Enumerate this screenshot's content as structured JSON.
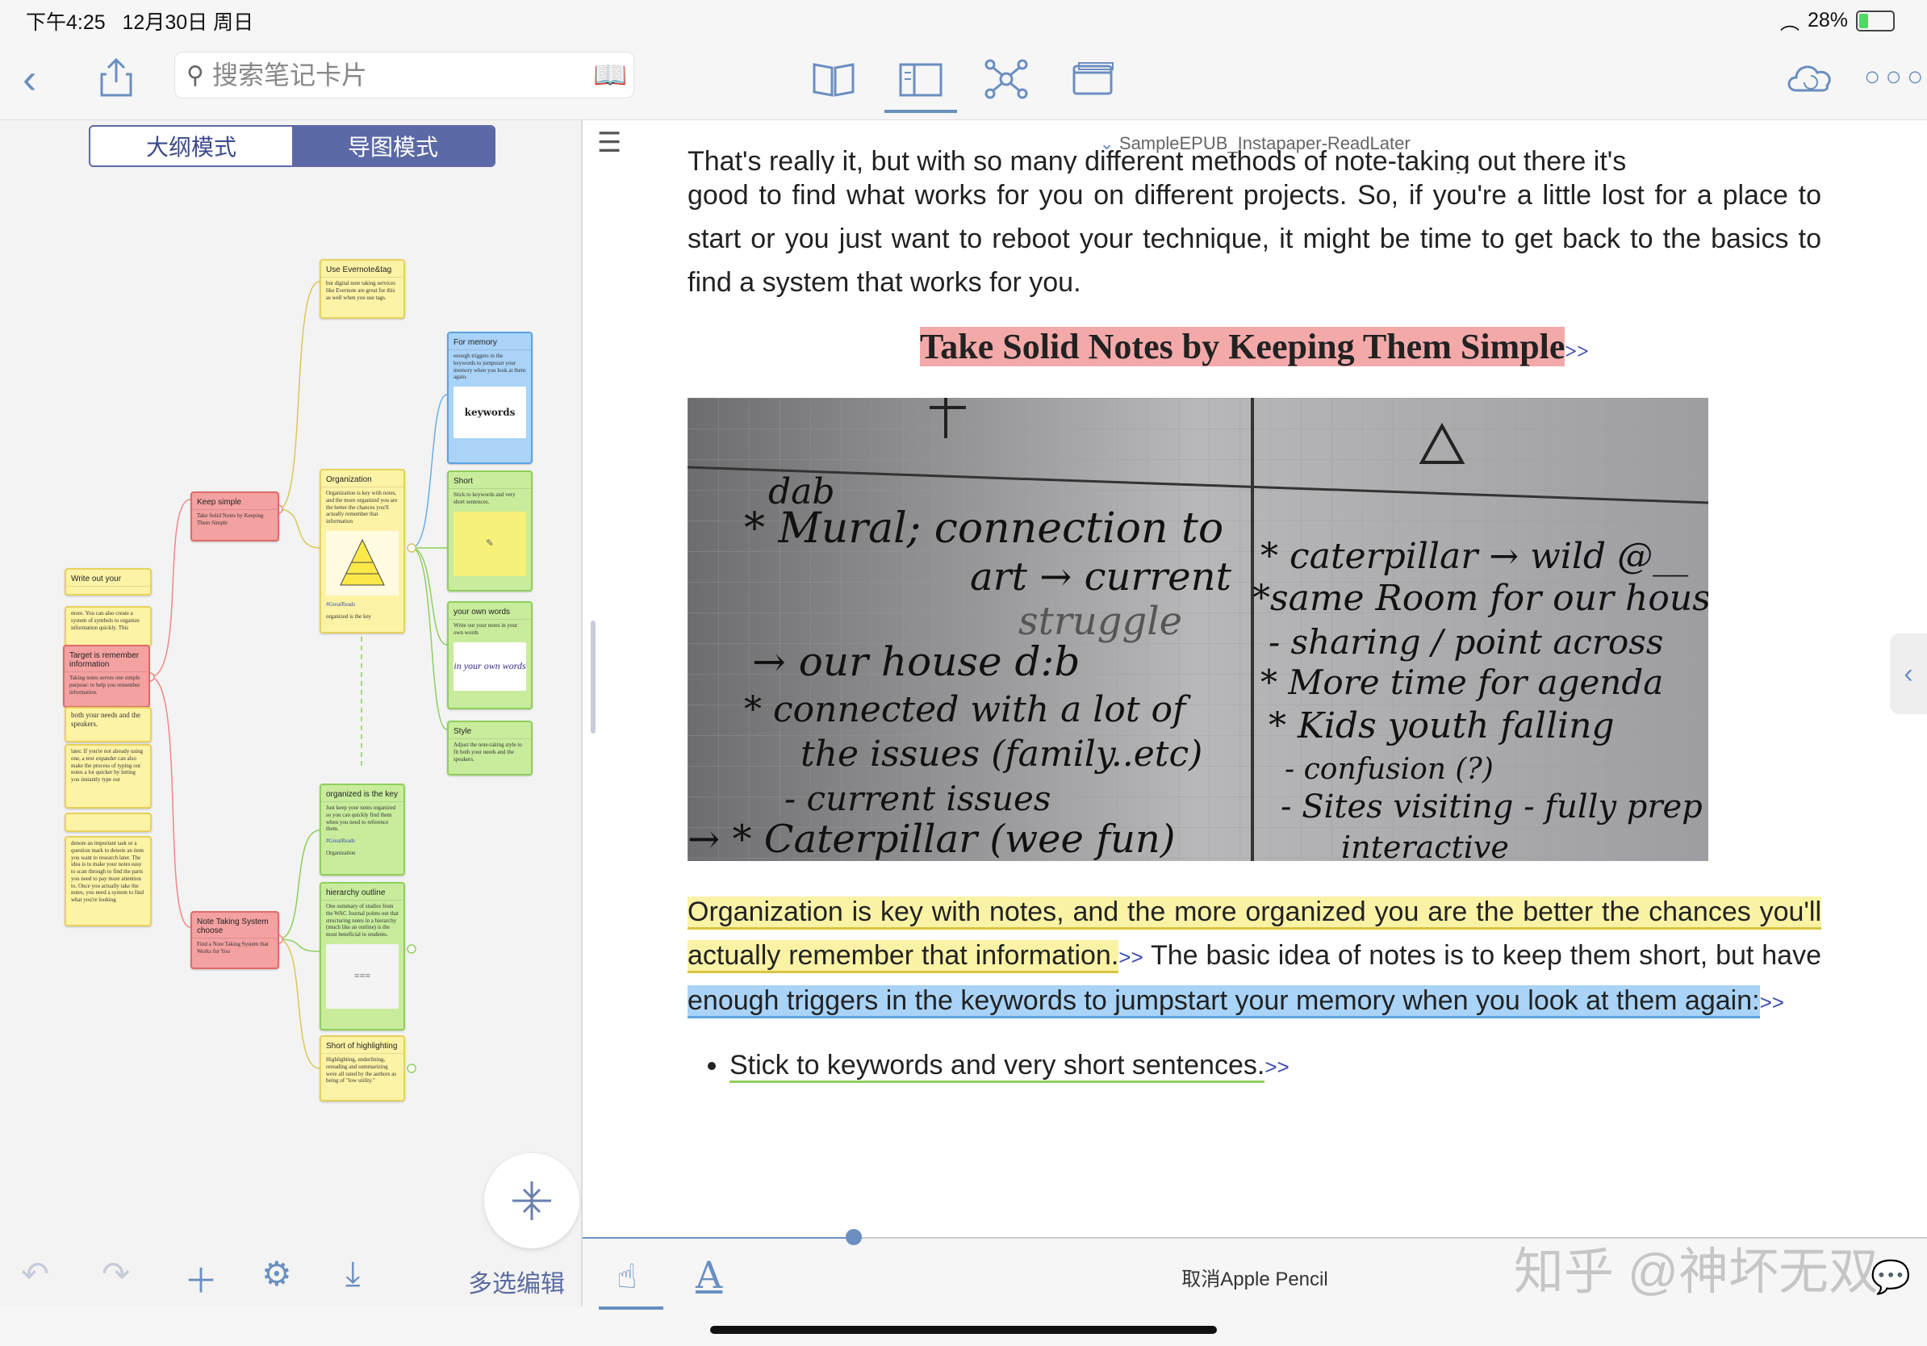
{
  "status": {
    "time": "下午4:25",
    "date": "12月30日 周日",
    "battery": "28%",
    "battery_level": 0.28
  },
  "toolbar": {
    "search_placeholder": "搜索笔记卡片",
    "icons": [
      "back-icon",
      "share-icon",
      "book-icon",
      "card-layout-icon",
      "mindmap-icon",
      "window-icon",
      "cloud-sync-icon",
      "more-icon"
    ]
  },
  "left": {
    "mode_outline": "大纲模式",
    "mode_map": "导图模式",
    "multi_edit": "多选编辑",
    "nodes": {
      "keep_simple": {
        "title": "Keep simple",
        "body": "Take Solid Notes by Keeping Them Simple"
      },
      "note_system": {
        "title": "Note Taking System choose",
        "body": "Find a Note Taking System that Works for You"
      },
      "target": {
        "title": "Target is remember information",
        "body": "Taking notes serves one simple purpose: to help you remember information."
      },
      "write_own": {
        "title": "Write out your"
      },
      "left2": {
        "body": "more. You can also create a system of symbols to organize information quickly. This"
      },
      "left3": {
        "body": "both your needs and the speakers."
      },
      "left4": {
        "body": "later. If you're not already using one, a text expander can also make the process of typing out notes a lot quicker by letting you instantly type out"
      },
      "left5": {
        "body": "denote an important task or a question mark to denote an item you want to research later. The idea is to make your notes easy to scan through to find the parts you need to pay more attention to. Once you actually take the notes, you need a system to find what you're looking"
      },
      "evernote": {
        "title": "Use Evernote&tag",
        "body": "but digital note taking services like Evernote are great for this as well when you use tags."
      },
      "organization": {
        "title": "Organization",
        "body": "Organization is key with notes, and the more organized you are the better the chances you'll actually remember that information",
        "tag": "#GreatReads",
        "foot": "organized is the key"
      },
      "for_memory": {
        "title": "For memory",
        "body": "enough triggers in the keywords to jumpstart your memory when you look at them again.",
        "thumb": "keywords"
      },
      "short": {
        "title": "Short",
        "body": "Stick to keywords and very short sentences."
      },
      "own_words": {
        "title": "your own words",
        "body": "Write out your notes in your own words",
        "thumb": "in your own words"
      },
      "style": {
        "title": "Style",
        "body": "Adjust the note-taking style to fit both your needs and the speakers."
      },
      "org_key": {
        "title": "organized is the key",
        "body": "Just keep your notes organized so you can quickly find them when you need to reference them.",
        "tag": "#GreatReads",
        "foot": "Organization"
      },
      "hierarchy": {
        "title": "hierarchy outline",
        "body": "One summary of studies from the WAC Journal points out that structuring notes in a hierarchy (much like an outline) is the most beneficial to students."
      },
      "highlight": {
        "title": "Short of highlighting",
        "body": "Highlighting, underlining, rereading and summarizing were all rated by the authors as being of \"low utility.\""
      }
    }
  },
  "reader": {
    "book_title": "SampleEPUB_Instapaper-ReadLater",
    "para_top_cut": "That's really it, but with so many different methods of note-taking out there it's",
    "para1": "good to find what works for you on different projects. So, if you're a little lost for a place to start or you just want to reboot your technique, it might be time to get back to the basics to find a system that works for you.",
    "heading": "Take Solid Notes by Keeping Them Simple",
    "link_arrow": ">>",
    "photo": {
      "left_lines": [
        "dab",
        "* Mural; connection to",
        "art → current",
        "struggle",
        "→ our house d:b",
        "* connected with a lot of",
        "the issues (family..etc)",
        "- current issues",
        "→ * Caterpillar (wee fun)"
      ],
      "right_lines": [
        "* caterpillar → wild @__",
        "*same Room for our house",
        "- sharing / point across",
        "* More time for agenda",
        "* Kids youth falling",
        "- confusion (?)",
        "- Sites visiting - fully prep",
        "interactive"
      ]
    },
    "para2_highlight_yellow": "Organization is key with notes, and the more organized you are the better the chances you'll actually remember that information.",
    "para2_plain": " The basic idea of notes is to keep them short, but have ",
    "para2_highlight_blue": "enough triggers in the keywords to jumpstart your memory when you look at them again:",
    "bullet1": "Stick to keywords and very short sentences.",
    "cancel_pencil": "取消Apple Pencil",
    "progress": 0.13
  },
  "watermark": "知乎 @神坏无双"
}
